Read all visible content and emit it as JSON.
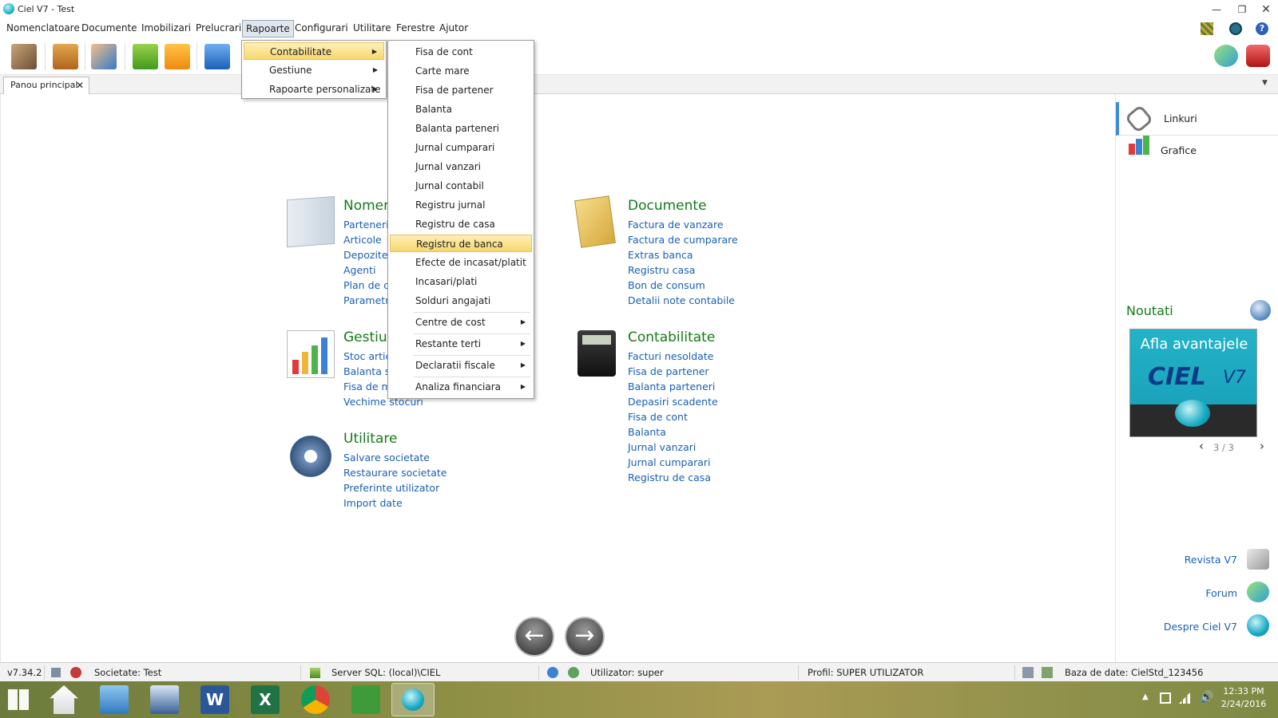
{
  "window": {
    "title": "Ciel V7 - Test"
  },
  "menubar": {
    "items": [
      "Nomenclatoare",
      "Documente",
      "Imobilizari",
      "Prelucrari",
      "Rapoarte",
      "Configurari",
      "Utilitare",
      "Ferestre",
      "Ajutor"
    ]
  },
  "tab": {
    "label": "Panou principal"
  },
  "rapoarte_menu": {
    "items": [
      "Contabilitate",
      "Gestiune",
      "Rapoarte personalizate"
    ]
  },
  "contabilitate_menu": {
    "items": [
      "Fisa de cont",
      "Carte mare",
      "Fisa de partener",
      "Balanta",
      "Balanta parteneri",
      "Jurnal cumparari",
      "Jurnal vanzari",
      "Jurnal contabil",
      "Registru jurnal",
      "Registru de casa",
      "Registru de banca",
      "Efecte de incasat/platit",
      "Incasari/plati",
      "Solduri angajati",
      "Centre de cost",
      "Restante terti",
      "Declaratii fiscale",
      "Analiza financiara"
    ]
  },
  "sections": {
    "nomenclatoare": {
      "title": "Nomenclatoare",
      "links": [
        "Parteneri",
        "Articole",
        "Depozite",
        "Agenti",
        "Plan de conturi",
        "Parametri"
      ]
    },
    "documente": {
      "title": "Documente",
      "links": [
        "Factura de vanzare",
        "Factura de cumparare",
        "Extras banca",
        "Registru casa",
        "Bon de consum",
        "Detalii note contabile"
      ]
    },
    "gestiune": {
      "title": "Gestiune",
      "links": [
        "Stoc articole",
        "Balanta stocuri",
        "Fisa de magazie",
        "Vechime stocuri"
      ]
    },
    "contabilitate": {
      "title": "Contabilitate",
      "links": [
        "Facturi nesoldate",
        "Fisa de partener",
        "Balanta parteneri",
        "Depasiri scadente",
        "Fisa de cont",
        "Balanta",
        "Jurnal vanzari",
        "Jurnal cumparari",
        "Registru de casa"
      ]
    },
    "utilitare": {
      "title": "Utilitare",
      "links": [
        "Salvare societate",
        "Restaurare societate",
        "Preferinte utilizator",
        "Import date"
      ]
    }
  },
  "rightpanel": {
    "linkuri": "Linkuri",
    "grafice": "Grafice",
    "noutati": "Noutati",
    "banner_text": "Afla avantajele",
    "banner_brand": "CIEL",
    "banner_version": "V7",
    "pager": "3 / 3",
    "bottom_links": [
      "Revista V7",
      "Forum",
      "Despre Ciel V7"
    ]
  },
  "statusbar": {
    "version": "v7.34.2",
    "societate": "Societate: Test",
    "server": "Server SQL: (local)\\CIEL",
    "utilizator": "Utilizator: super",
    "profil": "Profil: SUPER UTILIZATOR",
    "baza": "Baza de date: CielStd_123456"
  },
  "taskbar": {
    "time": "12:33 PM",
    "date": "2/24/2016"
  }
}
